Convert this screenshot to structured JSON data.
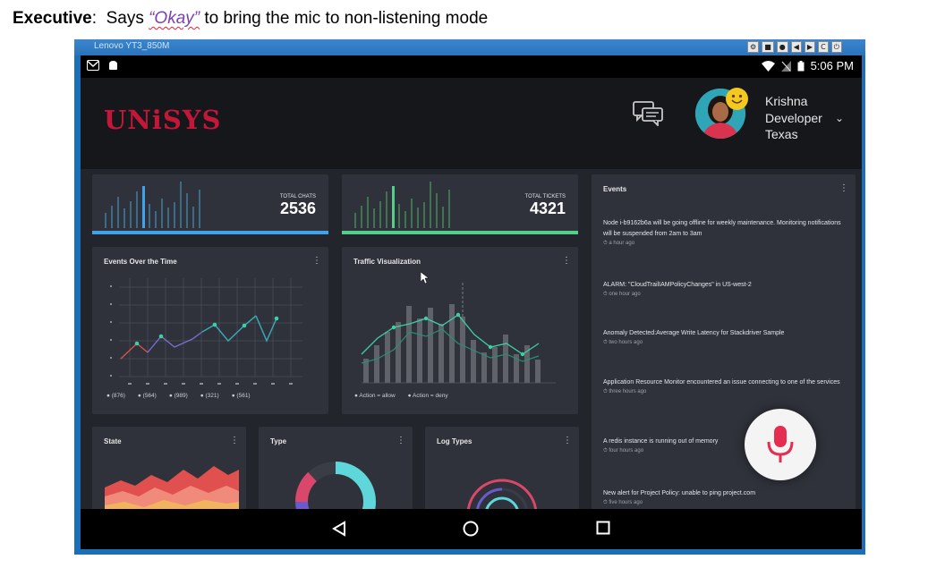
{
  "caption": {
    "speaker": "Executive",
    "colon": ":",
    "before": "  Says ",
    "quoted": "“Okay”",
    "after": " to bring the mic to non-listening mode"
  },
  "window": {
    "title": "Lenovo YT3_850M",
    "controls": [
      "⚙",
      "■",
      "●",
      "◀",
      "▶",
      "C",
      "⏻"
    ]
  },
  "statusbar": {
    "time": "5:06 PM"
  },
  "app": {
    "logo": "UNiSYS",
    "user": {
      "name": "Krishna",
      "role": "Developer",
      "location": "Texas"
    },
    "chevron": "⌄"
  },
  "stat_chats": {
    "label": "TOTAL CHATS",
    "value": "2536",
    "accent": "#3ea3e8"
  },
  "stat_tickets": {
    "label": "TOTAL TICKETS",
    "value": "4321",
    "accent": "#52d08a"
  },
  "events_over_time": {
    "title": "Events Over the Time",
    "menu": "⋮",
    "legend": [
      "(876)",
      "(564)",
      "(989)",
      "(321)",
      "(561)"
    ]
  },
  "traffic": {
    "title": "Traffic Visualization",
    "menu": "⋮",
    "legend": [
      "Action = allow",
      "Action = deny"
    ]
  },
  "events": {
    "title": "Events",
    "menu": "⋮",
    "items": [
      {
        "text": "Node i-b9162b6a will be going offline for weekly maintenance. Monitoring notifications will be suspended from 2am to 3am",
        "time": "a hour ago"
      },
      {
        "text": "ALARM: \"CloudTrailIAMPolicyChanges\" in US-west-2",
        "time": "one hour ago"
      },
      {
        "text": "Anomaly Detected:Average Write Latency for Stackdriver Sample",
        "time": "two hours ago"
      },
      {
        "text": "Application Resource Monitor encountered an issue connecting to one of the services",
        "time": "three hours ago"
      },
      {
        "text": "A redis instance is running out of memory",
        "time": "four hours ago"
      },
      {
        "text": "New alert for Project Policy: unable to ping project.com",
        "time": "five hours ago"
      }
    ]
  },
  "state": {
    "title": "State",
    "menu": "⋮"
  },
  "type_card": {
    "title": "Type",
    "menu": "⋮"
  },
  "log_types": {
    "title": "Log Types",
    "menu": "⋮"
  }
}
